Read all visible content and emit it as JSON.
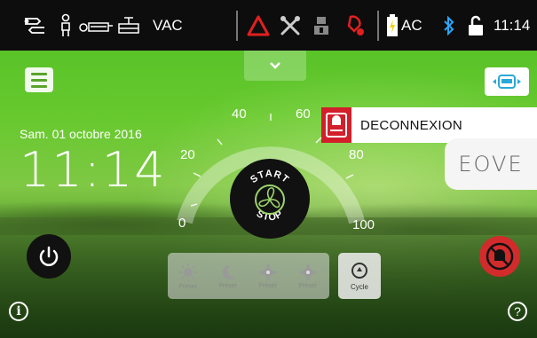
{
  "status_bar": {
    "mode_label": "VAC",
    "power_label": "AC",
    "time": "11:14",
    "icons": [
      "patient-circuit-icon",
      "person-valve-icon",
      "circuit-icon",
      "valve-icon",
      "warning-triangle-icon",
      "tools-icon",
      "maintenance-icon",
      "disconnect-icon",
      "battery-icon",
      "bluetooth-icon",
      "unlock-icon"
    ],
    "colors": {
      "warning": "#e02020",
      "bluetooth": "#2aa8ff",
      "battery": "#f0d21a"
    }
  },
  "home": {
    "date": "Sam. 01 octobre 2016",
    "clock": "11:14",
    "alarm_text": "DECONNEXION",
    "logo_text": "EOVE"
  },
  "dial": {
    "ticks": [
      "0",
      "20",
      "40",
      "60",
      "80",
      "100"
    ],
    "start_label": "START",
    "stop_label": "STOP"
  },
  "modes": {
    "items": [
      {
        "label": "Preset",
        "icon": "sun-icon"
      },
      {
        "label": "Preset",
        "icon": "moon-icon"
      },
      {
        "label": "Preset",
        "icon": "gear-icon"
      },
      {
        "label": "Preset",
        "icon": "gear-icon"
      }
    ],
    "cycle_label": "Cycle"
  },
  "theme": {
    "accent": "#5aa22d",
    "alarm": "#d21f2b"
  }
}
